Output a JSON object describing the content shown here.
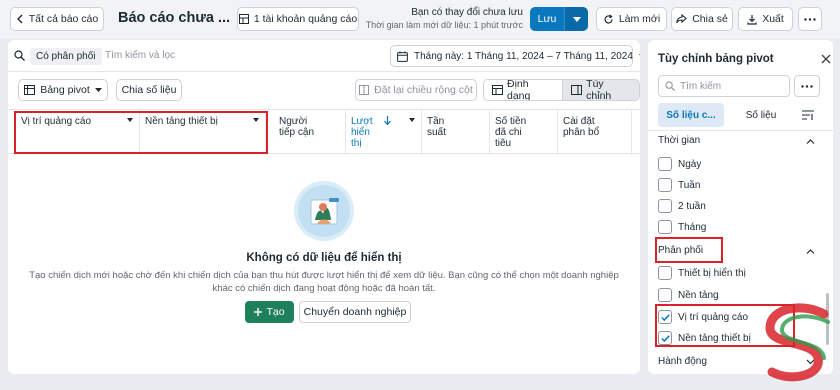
{
  "topbar": {
    "back_label": "Tất cả báo cáo",
    "title": "Báo cáo chưa ...",
    "accounts_label": "1 tài khoản quảng cáo",
    "unsaved_line1": "Bạn có thay đổi chưa lưu",
    "unsaved_line2": "Thời gian làm mới dữ liệu: 1 phút trước",
    "save_label": "Lưu",
    "refresh_label": "Làm mới",
    "share_label": "Chia sẻ",
    "export_label": "Xuất"
  },
  "filter": {
    "chip_label": "Có phân phối",
    "search_placeholder": "Tìm kiếm và lọc",
    "date_label": "Tháng này: 1 Tháng 11, 2024 – 7 Tháng 11, 2024"
  },
  "toolbar": {
    "pivot_label": "Bảng pivot",
    "split_label": "Chia số liệu",
    "reset_width_label": "Đặt lại chiều rộng cột",
    "format_label": "Định dạng",
    "customize_label": "Tùy chỉnh"
  },
  "table": {
    "columns": [
      {
        "label": "Vị trí quảng cáo",
        "dropdown": true
      },
      {
        "label": "Nền tảng thiết bị",
        "dropdown": true
      },
      {
        "label": "Người tiếp cận",
        "dropdown": false
      },
      {
        "label": "Lượt hiển thị",
        "dropdown": true,
        "sorted": true
      },
      {
        "label": "Tần suất",
        "dropdown": false
      },
      {
        "label": "Số tiền đã chi tiêu",
        "dropdown": false
      },
      {
        "label": "Cài đặt phân bổ",
        "dropdown": false
      }
    ]
  },
  "empty": {
    "title": "Không có dữ liệu để hiển thị",
    "description": "Tạo chiến dịch mới hoặc chờ đến khi chiến dịch của bạn thu hút được lượt hiển thị để xem dữ liệu. Bạn cũng có thể chọn một doanh nghiệp khác có chiến dịch đang hoạt động hoặc đã hoàn tất.",
    "create_label": "Tạo",
    "switch_label": "Chuyển doanh nghiệp"
  },
  "side": {
    "title": "Tùy chỉnh bảng pivot",
    "search_placeholder": "Tìm kiếm",
    "tab_metrics": "Số liệu c...",
    "tab_data": "Số liệu",
    "sections": {
      "time": "Thời gian",
      "delivery": "Phân phối",
      "action": "Hành động"
    },
    "time_options": [
      "Ngày",
      "Tuần",
      "2 tuần",
      "Tháng"
    ],
    "delivery_options": [
      {
        "label": "Thiết bị hiển thị",
        "checked": false
      },
      {
        "label": "Nền tảng",
        "checked": false
      },
      {
        "label": "Vị trí quảng cáo",
        "checked": true
      },
      {
        "label": "Nền tảng thiết bị",
        "checked": true
      }
    ]
  },
  "colors": {
    "primary": "#0a78be",
    "create_green": "#1e7f5b",
    "highlight_red": "#d8232a",
    "background": "#e9ecf0"
  }
}
